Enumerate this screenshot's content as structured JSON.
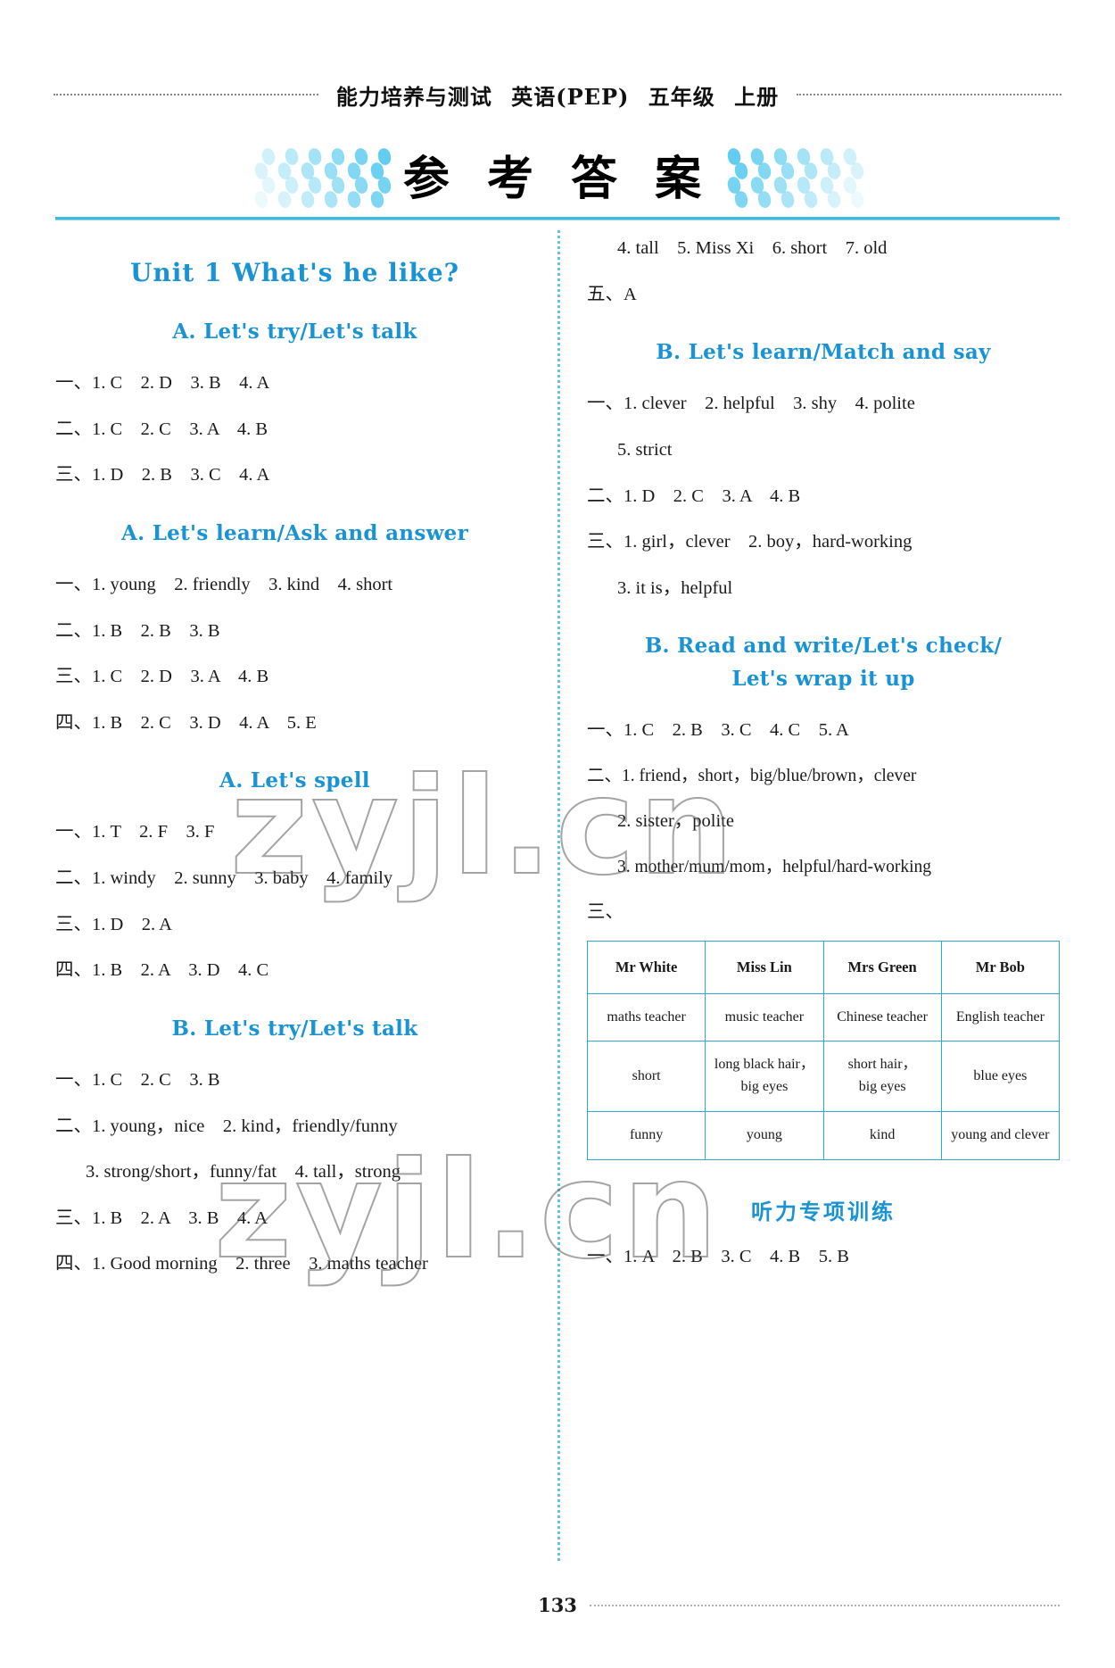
{
  "running_head": {
    "title": "能力培养与测试",
    "subject": "英语(PEP)",
    "grade": "五年级",
    "volume": "上册"
  },
  "page_title": "参 考 答 案",
  "footer": {
    "page_number": "133"
  },
  "watermark": {
    "text": "zyjl.cn"
  },
  "colors": {
    "accent_blue": "#1a93d4",
    "rule_blue": "#3fb9e0",
    "table_border": "#2fa8d8",
    "dot_decoration": "#63cdf0"
  },
  "left_column": {
    "unit_title": "Unit 1   What's he like?",
    "sections": [
      {
        "heading": "A. Let's try/Let's talk",
        "answers": [
          "一、1. C　2. D　3. B　4. A",
          "二、1. C　2. C　3. A　4. B",
          "三、1. D　2. B　3. C　4. A"
        ]
      },
      {
        "heading": "A. Let's learn/Ask and answer",
        "answers": [
          "一、1. young　2. friendly　3. kind　4. short",
          "二、1. B　2. B　3. B",
          "三、1. C　2. D　3. A　4. B",
          "四、1. B　2. C　3. D　4. A　5. E"
        ]
      },
      {
        "heading": "A. Let's spell",
        "answers": [
          "一、1. T　2. F　3. F",
          "二、1. windy　2. sunny　3. baby　4. family",
          "三、1. D　2. A",
          "四、1. B　2. A　3. D　4. C"
        ]
      },
      {
        "heading": "B. Let's try/Let's talk",
        "answers": [
          "一、1. C　2. C　3. B",
          "二、1. young，nice　2. kind，friendly/funny",
          "3. strong/short，funny/fat　4. tall，strong",
          "三、1. B　2. A　3. B　4. A",
          "四、1. Good morning　2. three　3. maths teacher"
        ]
      }
    ]
  },
  "right_column": {
    "continued_answers": [
      "4. tall　5. Miss Xi　6. short　7. old",
      "五、A"
    ],
    "sections": [
      {
        "heading": "B. Let's learn/Match and say",
        "answers": [
          "一、1. clever　2. helpful　3. shy　4. polite",
          "5. strict",
          "二、1. D　2. C　3. A　4. B",
          "三、1. girl，clever　2. boy，hard-working",
          "3. it is，helpful"
        ]
      },
      {
        "heading_line1": "B. Read and write/Let's check/",
        "heading_line2": "Let's wrap it up",
        "answers": [
          "一、1. C　2. B　3. C　4. C　5. A",
          "二、1. friend，short，big/blue/brown，clever",
          "2. sister，polite",
          "3. mother/mum/mom，helpful/hard-working",
          "三、"
        ]
      }
    ],
    "table": {
      "columns": [
        "Mr White",
        "Miss Lin",
        "Mrs Green",
        "Mr Bob"
      ],
      "rows": [
        [
          "maths teacher",
          "music teacher",
          "Chinese teacher",
          "English teacher"
        ],
        [
          [
            "short"
          ],
          [
            "long black hair，",
            "big eyes"
          ],
          [
            "short hair，",
            "big eyes"
          ],
          [
            "blue eyes"
          ]
        ],
        [
          "funny",
          "young",
          "kind",
          "young and clever"
        ]
      ]
    },
    "listening_section": {
      "heading": "听力专项训练",
      "answers": [
        "一、1. A　2. B　3. C　4. B　5. B"
      ]
    }
  }
}
